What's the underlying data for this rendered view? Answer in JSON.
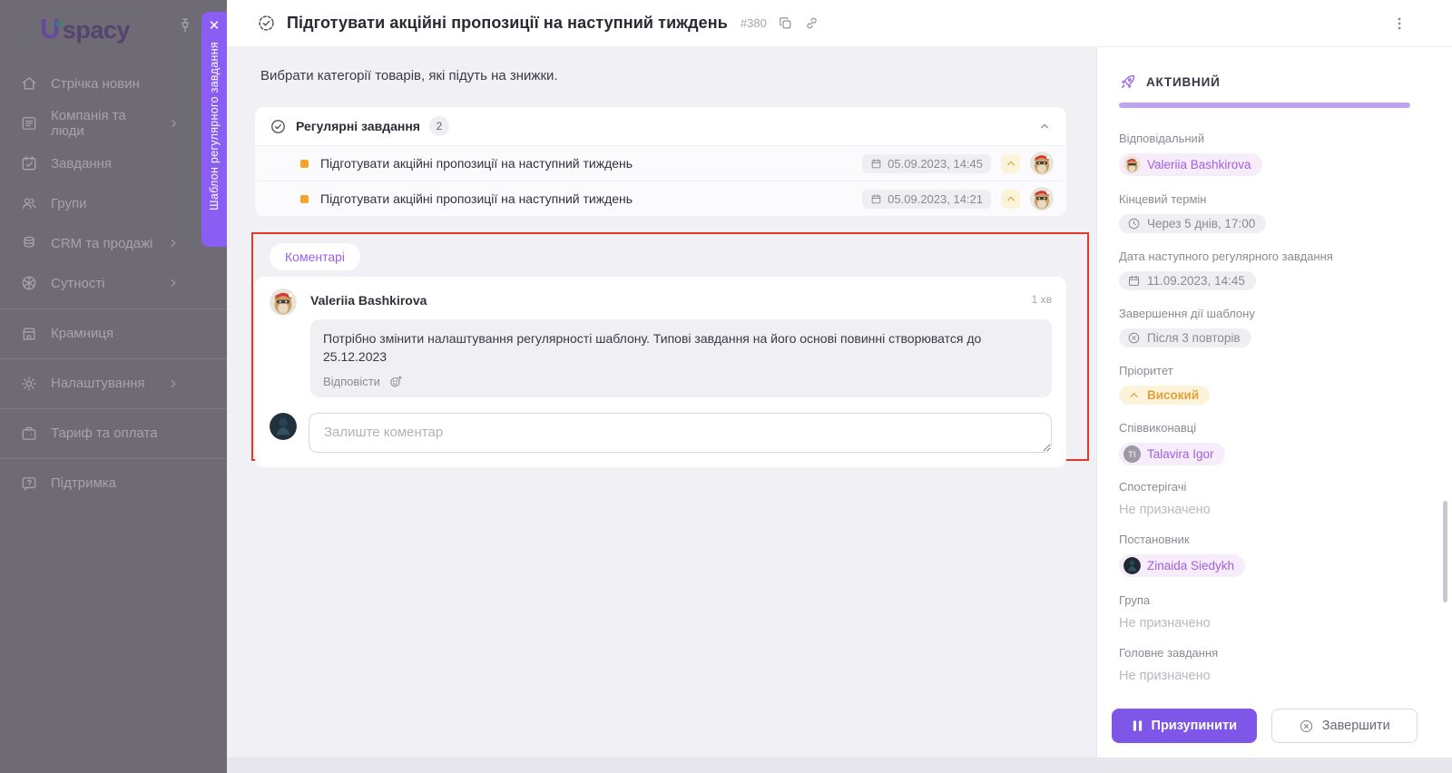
{
  "sidebar": {
    "logo_letter": "U",
    "logo_text": "spacy",
    "items": [
      {
        "label": "Стрічка новин"
      },
      {
        "label": "Компанія та люди"
      },
      {
        "label": "Завдання"
      },
      {
        "label": "Групи"
      },
      {
        "label": "CRM та продажі"
      },
      {
        "label": "Сутності"
      },
      {
        "label": "Крамниця"
      },
      {
        "label": "Налаштування"
      },
      {
        "label": "Тариф та оплата"
      },
      {
        "label": "Підтримка"
      }
    ]
  },
  "ribbon": {
    "label": "Шаблон регулярного завдання",
    "close": "✕"
  },
  "header": {
    "title": "Підготувати акційні пропозиції на наступний тиждень",
    "task_id": "#380"
  },
  "description": "Вибрати категорії товарів, які підуть на знижки.",
  "regular_tasks": {
    "title": "Регулярні завдання",
    "count": "2",
    "rows": [
      {
        "title": "Підготувати акційні пропозиції на наступний тиждень",
        "date": "05.09.2023, 14:45"
      },
      {
        "title": "Підготувати акційні пропозиції на наступний тиждень",
        "date": "05.09.2023, 14:21"
      }
    ]
  },
  "comments": {
    "tab": "Коментарі",
    "comment": {
      "author": "Valeriia Bashkirova",
      "time": "1 хв",
      "text": "Потрібно змінити налаштування регулярності шаблону. Типові завдання на його основі повинні створюватся до 25.12.2023",
      "reply": "Відповісти"
    },
    "input_placeholder": "Залиште коментар"
  },
  "panel": {
    "status": "АКТИВНИЙ",
    "fields": [
      {
        "label": "Відповідальний",
        "value": "Valeriia Bashkirova"
      },
      {
        "label": "Кінцевий термін",
        "value": "Через 5 днів, 17:00"
      },
      {
        "label": "Дата наступного регулярного завдання",
        "value": "11.09.2023, 14:45"
      },
      {
        "label": "Завершення дії шаблону",
        "value": "Після 3 повторів"
      },
      {
        "label": "Пріоритет",
        "value": "Високий"
      },
      {
        "label": "Співвиконавці",
        "value": "Talavira Igor",
        "initials": "TI"
      },
      {
        "label": "Спостерігачі",
        "value": "Не призначено"
      },
      {
        "label": "Постановник",
        "value": "Zinaida Siedykh"
      },
      {
        "label": "Група",
        "value": "Не призначено"
      },
      {
        "label": "Головне завдання",
        "value": "Не призначено"
      }
    ],
    "buttons": {
      "pause": "Призупинити",
      "complete": "Завершити"
    }
  },
  "colors": {
    "accent": "#8a5ef2",
    "priority": "#e4a23c",
    "annotation": "#e8372a",
    "status_bar": "#bda4f0"
  }
}
